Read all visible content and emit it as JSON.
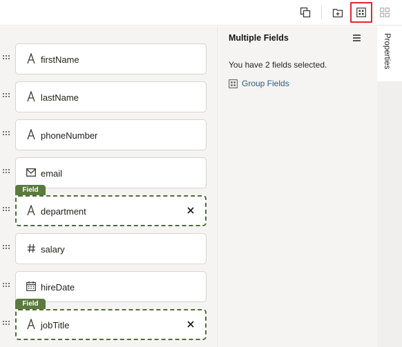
{
  "toolbar": {
    "buttons": [
      {
        "name": "duplicate",
        "icon": "copy-icon"
      },
      {
        "name": "add-to-new-group",
        "icon": "folder-add-icon"
      },
      {
        "name": "group-fields",
        "icon": "group-grid-icon",
        "highlighted": true
      },
      {
        "name": "ungroup-fields",
        "icon": "ungroup-grid-icon",
        "disabled": true
      }
    ]
  },
  "canvas": {
    "fields": [
      {
        "label": "firstName",
        "icon": "text-type-icon",
        "selected": false
      },
      {
        "label": "lastName",
        "icon": "text-type-icon",
        "selected": false
      },
      {
        "label": "phoneNumber",
        "icon": "text-type-icon",
        "selected": false
      },
      {
        "label": "email",
        "icon": "envelope-icon",
        "selected": false
      },
      {
        "label": "department",
        "icon": "text-type-icon",
        "selected": true,
        "tag": "Field"
      },
      {
        "label": "salary",
        "icon": "hash-icon",
        "selected": false
      },
      {
        "label": "hireDate",
        "icon": "calendar-icon",
        "selected": false
      },
      {
        "label": "jobTitle",
        "icon": "text-type-icon",
        "selected": true,
        "tag": "Field"
      }
    ]
  },
  "properties": {
    "title": "Multiple Fields",
    "message": "You have 2 fields selected.",
    "group_link": "Group Fields",
    "tab_label": "Properties"
  },
  "colors": {
    "selected_border": "#4e6b36",
    "tag_bg": "#5a7a3e",
    "highlight": "#e0262a",
    "link": "#2d5a7a"
  }
}
